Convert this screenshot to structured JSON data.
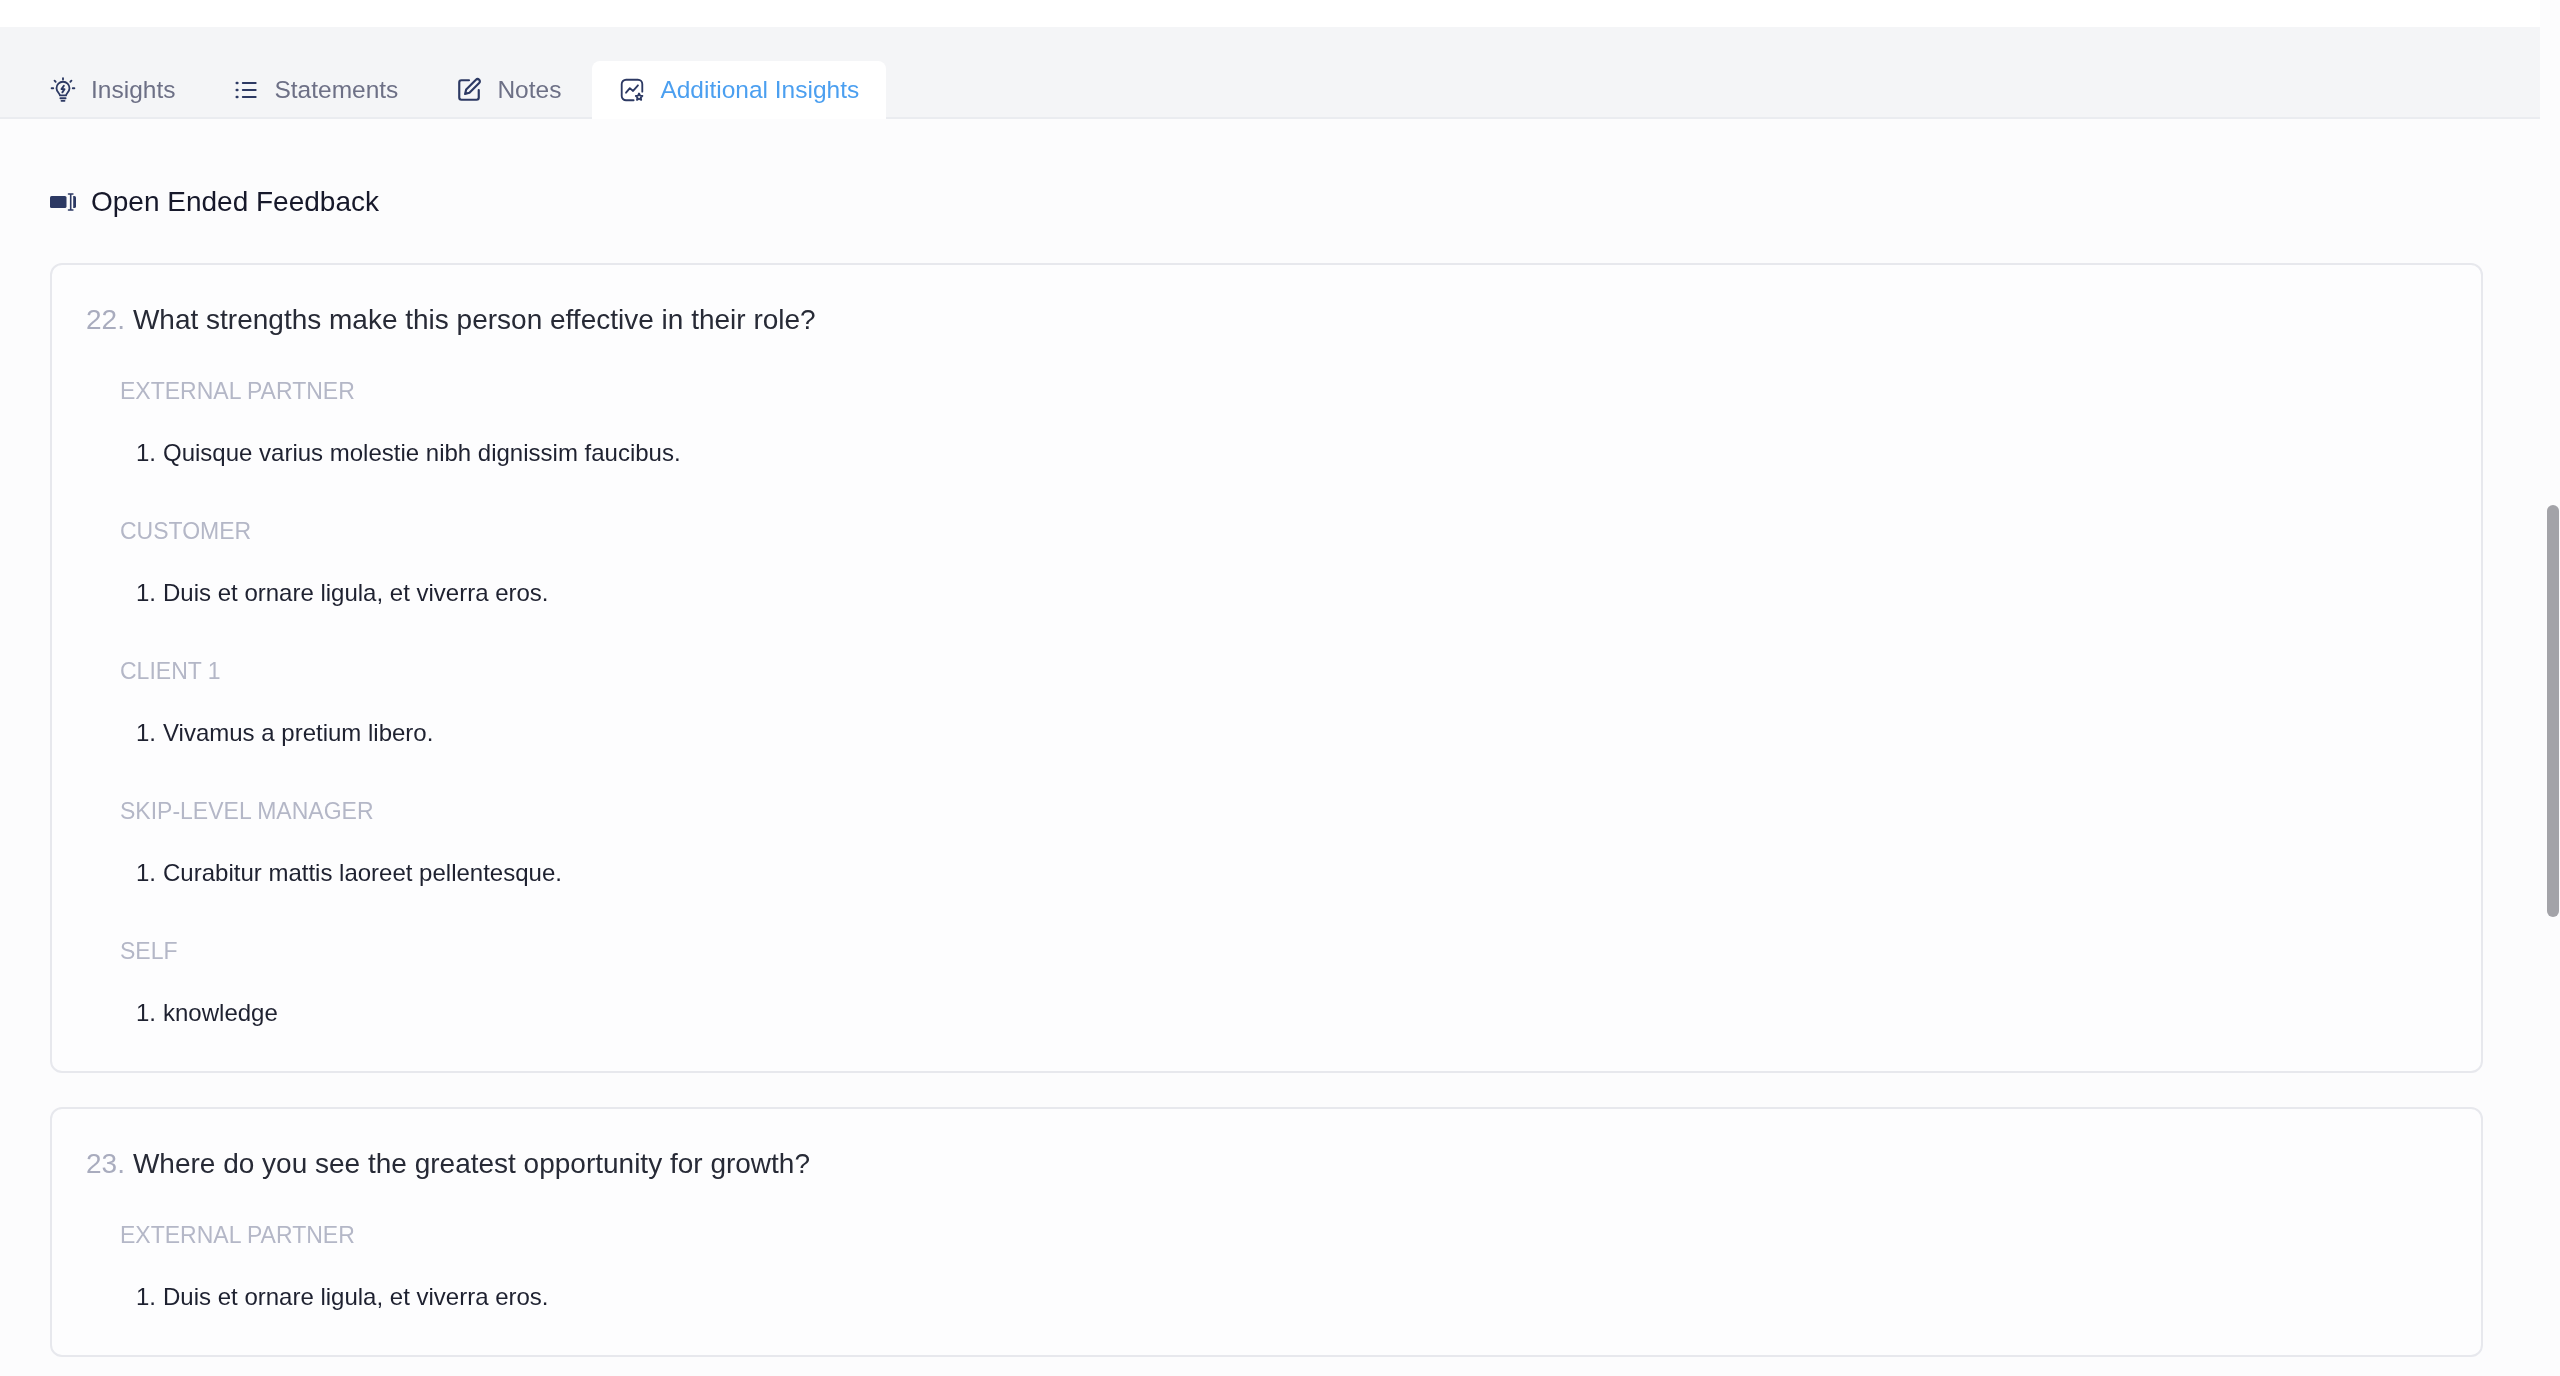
{
  "tabs": [
    {
      "label": "Insights",
      "selected": false
    },
    {
      "label": "Statements",
      "selected": false
    },
    {
      "label": "Notes",
      "selected": false
    },
    {
      "label": "Additional Insights",
      "selected": true
    }
  ],
  "section": {
    "title": "Open Ended Feedback"
  },
  "questions": [
    {
      "number": "22.",
      "text": "What strengths make this person effective in their role?",
      "groups": [
        {
          "label": "EXTERNAL PARTNER",
          "answers": [
            {
              "number": "1.",
              "text": "Quisque varius molestie nibh dignissim faucibus."
            }
          ]
        },
        {
          "label": "CUSTOMER",
          "answers": [
            {
              "number": "1.",
              "text": "Duis et ornare ligula, et viverra eros."
            }
          ]
        },
        {
          "label": "CLIENT 1",
          "answers": [
            {
              "number": "1.",
              "text": "Vivamus a pretium libero."
            }
          ]
        },
        {
          "label": "SKIP-LEVEL MANAGER",
          "answers": [
            {
              "number": "1.",
              "text": "Curabitur mattis laoreet pellentesque."
            }
          ]
        },
        {
          "label": "SELF",
          "answers": [
            {
              "number": "1.",
              "text": "knowledge"
            }
          ]
        }
      ]
    },
    {
      "number": "23.",
      "text": "Where do you see the greatest opportunity for growth?",
      "groups": [
        {
          "label": "EXTERNAL PARTNER",
          "answers": [
            {
              "number": "1.",
              "text": "Duis et ornare ligula, et viverra eros."
            }
          ]
        }
      ]
    }
  ]
}
